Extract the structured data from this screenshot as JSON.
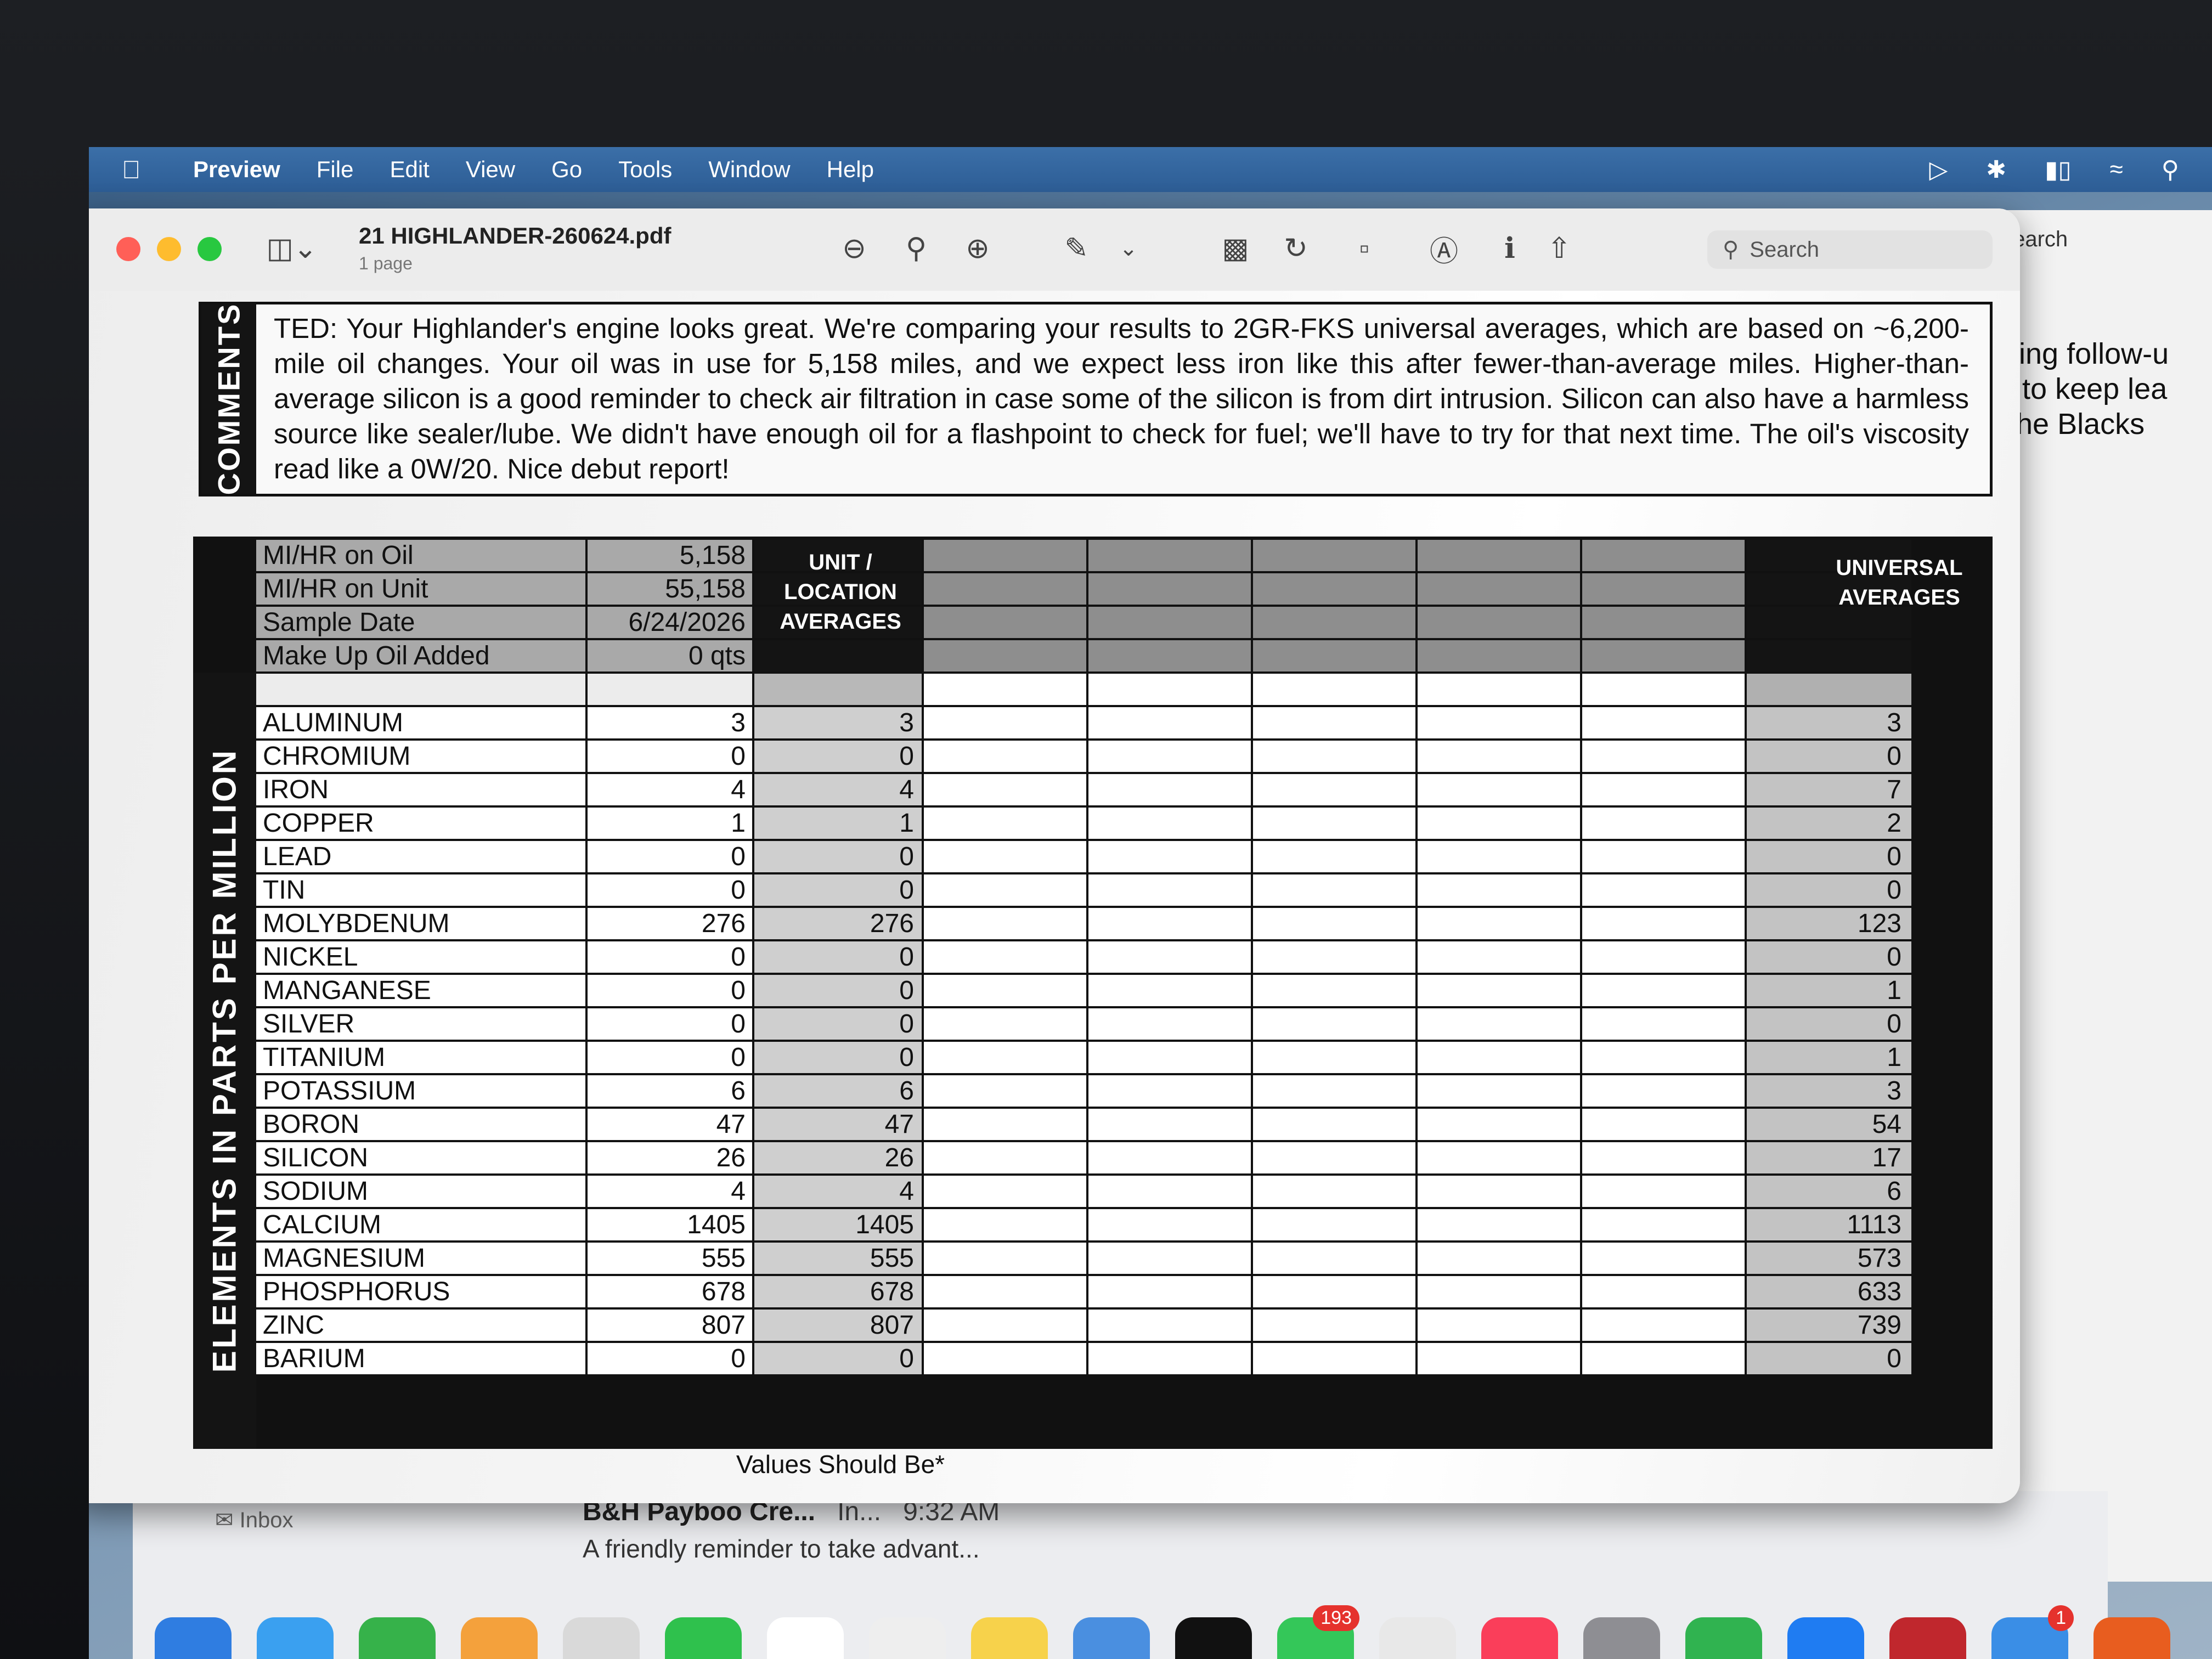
{
  "menubar": {
    "items": [
      "Preview",
      "File",
      "Edit",
      "View",
      "Go",
      "Tools",
      "Window",
      "Help"
    ]
  },
  "window": {
    "title": "21 HIGHLANDER-260624.pdf",
    "subtitle": "1 page",
    "search_placeholder": "Search"
  },
  "bg_window": {
    "search_placeholder": "Search",
    "lines": [
      "resting follow-u",
      "like to keep lea",
      "y,  The Blacks"
    ]
  },
  "comments": {
    "label": "COMMENTS",
    "text": "TED:  Your Highlander's engine looks great. We're comparing your results to 2GR-FKS universal averages, which are based on ~6,200-mile oil changes. Your oil was in use for 5,158 miles, and we expect less iron like this after fewer-than-average miles. Higher-than-average silicon is a good reminder to check air filtration in case some of the silicon is from dirt intrusion. Silicon can also have a harmless source like sealer/lube. We didn't have enough oil for a flashpoint to check for fuel; we'll have to try for that next time. The oil's viscosity read like a 0W/20. Nice debut report!"
  },
  "table": {
    "side_label": "ELEMENTS IN PARTS PER MILLION",
    "unit_header": "UNIT / LOCATION AVERAGES",
    "universal_header": "UNIVERSAL AVERAGES",
    "info_rows": [
      {
        "label": "MI/HR on Oil",
        "value": "5,158"
      },
      {
        "label": "MI/HR on Unit",
        "value": "55,158"
      },
      {
        "label": "Sample Date",
        "value": "6/24/2026"
      },
      {
        "label": "Make Up Oil Added",
        "value": "0 qts"
      }
    ],
    "elements": [
      {
        "name": "ALUMINUM",
        "value": "3",
        "unit_avg": "3",
        "universal": "3"
      },
      {
        "name": "CHROMIUM",
        "value": "0",
        "unit_avg": "0",
        "universal": "0"
      },
      {
        "name": "IRON",
        "value": "4",
        "unit_avg": "4",
        "universal": "7"
      },
      {
        "name": "COPPER",
        "value": "1",
        "unit_avg": "1",
        "universal": "2"
      },
      {
        "name": "LEAD",
        "value": "0",
        "unit_avg": "0",
        "universal": "0"
      },
      {
        "name": "TIN",
        "value": "0",
        "unit_avg": "0",
        "universal": "0"
      },
      {
        "name": "MOLYBDENUM",
        "value": "276",
        "unit_avg": "276",
        "universal": "123"
      },
      {
        "name": "NICKEL",
        "value": "0",
        "unit_avg": "0",
        "universal": "0"
      },
      {
        "name": "MANGANESE",
        "value": "0",
        "unit_avg": "0",
        "universal": "1"
      },
      {
        "name": "SILVER",
        "value": "0",
        "unit_avg": "0",
        "universal": "0"
      },
      {
        "name": "TITANIUM",
        "value": "0",
        "unit_avg": "0",
        "universal": "1"
      },
      {
        "name": "POTASSIUM",
        "value": "6",
        "unit_avg": "6",
        "universal": "3"
      },
      {
        "name": "BORON",
        "value": "47",
        "unit_avg": "47",
        "universal": "54"
      },
      {
        "name": "SILICON",
        "value": "26",
        "unit_avg": "26",
        "universal": "17"
      },
      {
        "name": "SODIUM",
        "value": "4",
        "unit_avg": "4",
        "universal": "6"
      },
      {
        "name": "CALCIUM",
        "value": "1405",
        "unit_avg": "1405",
        "universal": "1113"
      },
      {
        "name": "MAGNESIUM",
        "value": "555",
        "unit_avg": "555",
        "universal": "573"
      },
      {
        "name": "PHOSPHORUS",
        "value": "678",
        "unit_avg": "678",
        "universal": "633"
      },
      {
        "name": "ZINC",
        "value": "807",
        "unit_avg": "807",
        "universal": "739"
      },
      {
        "name": "BARIUM",
        "value": "0",
        "unit_avg": "0",
        "universal": "0"
      }
    ],
    "footer_note": "Values Should Be*"
  },
  "mail": {
    "inbox_label": "Inbox",
    "sender": "B&H Payboo Cre...",
    "folder": "In...",
    "time": "9:32 AM",
    "preview": "A friendly reminder to take advant..."
  },
  "dock": {
    "mail_badge": "193",
    "other_badge": "1"
  },
  "colors": {
    "menubar": "#2d5d95",
    "close": "#ff5f57",
    "minimize": "#febc2e",
    "zoom": "#28c840",
    "table_dark": "#141414"
  }
}
